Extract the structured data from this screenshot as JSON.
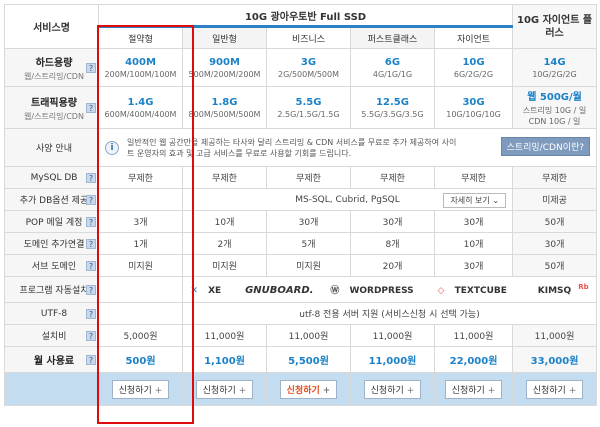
{
  "header": {
    "service_name": "서비스명",
    "ssd_group_title": "10G 광아우토반 Full SSD",
    "dedicated_title": "10G 자이언트 플러스",
    "plans": [
      "절약형",
      "일반형",
      "비즈니스",
      "퍼스트클래스",
      "자이언트"
    ]
  },
  "rows": {
    "disk": {
      "label": "하드용량",
      "sub": "웹/스트리밍/CDN",
      "values": [
        {
          "main": "400M",
          "sub": "200M/100M/100M"
        },
        {
          "main": "900M",
          "sub": "500M/200M/200M"
        },
        {
          "main": "3G",
          "sub": "2G/500M/500M"
        },
        {
          "main": "6G",
          "sub": "4G/1G/1G"
        },
        {
          "main": "10G",
          "sub": "6G/2G/2G"
        },
        {
          "main": "14G",
          "sub": "10G/2G/2G"
        }
      ]
    },
    "traffic": {
      "label": "트래픽용량",
      "sub": "웹/스트리밍/CDN",
      "values": [
        {
          "main": "1.4G",
          "sub": "600M/400M/400M"
        },
        {
          "main": "1.8G",
          "sub": "800M/500M/500M"
        },
        {
          "main": "5.5G",
          "sub": "2.5G/1.5G/1.5G"
        },
        {
          "main": "12.5G",
          "sub": "5.5G/3.5G/3.5G"
        },
        {
          "main": "30G",
          "sub": "10G/10G/10G"
        },
        {
          "main": "웹 500G/월",
          "sub": "스트리밍 10G / 일",
          "sub2": "CDN 10G / 일"
        }
      ]
    },
    "usage": {
      "label": "사양 안내",
      "notice": "일반적인 웹 공간만을 제공하는 타사와 달리 스트리밍 & CDN 서비스를 무료로 추가 제공하여 사이트 운영자의 효과 및 고급 서비스를 무료로 사용할 기회를 드립니다.",
      "button": "스트리밍/CDN이란?"
    },
    "mysql": {
      "label": "MySQL DB",
      "values": [
        "무제한",
        "무제한",
        "무제한",
        "무제한",
        "무제한",
        "무제한"
      ]
    },
    "db_option": {
      "label": "추가 DB옵션 제공",
      "text": "MS-SQL, Cubrid, PgSQL",
      "detail_btn": "자세히 보기",
      "last": "미제공"
    },
    "pop": {
      "label": "POP 메일 계정",
      "values": [
        "3개",
        "10개",
        "30개",
        "30개",
        "30개",
        "50개"
      ]
    },
    "domain": {
      "label": "도메인 추가연결",
      "values": [
        "1개",
        "2개",
        "5개",
        "8개",
        "10개",
        "30개"
      ]
    },
    "subdomain": {
      "label": "서브 도메인",
      "values": [
        "미지원",
        "미지원",
        "미지원",
        "20개",
        "30개",
        "50개"
      ]
    },
    "autoinstall": {
      "label": "프로그램 자동설치",
      "logos": [
        "XE",
        "GNUBOARD.",
        "WORDPRESS",
        "TEXTCUBE",
        "KIMSQ"
      ]
    },
    "utf8": {
      "label": "UTF-8",
      "text": "utf-8 전용 서버 지원 (서비스신청 시 선택 가능)"
    },
    "setup": {
      "label": "설치비",
      "values": [
        "5,000원",
        "11,000원",
        "11,000원",
        "11,000원",
        "11,000원",
        "11,000원"
      ]
    },
    "monthly": {
      "label": "월 사용료",
      "values": [
        "500원",
        "1,100원",
        "5,500원",
        "11,000원",
        "22,000원",
        "33,000원"
      ]
    }
  },
  "footer": {
    "apply_label": "신청하기",
    "plus": "+"
  },
  "colors": {
    "accent": "#1b82c8",
    "highlight_box": "#e00a0a",
    "footer_bg": "#c4dcef",
    "apply_highlight": "#e04b1b"
  }
}
